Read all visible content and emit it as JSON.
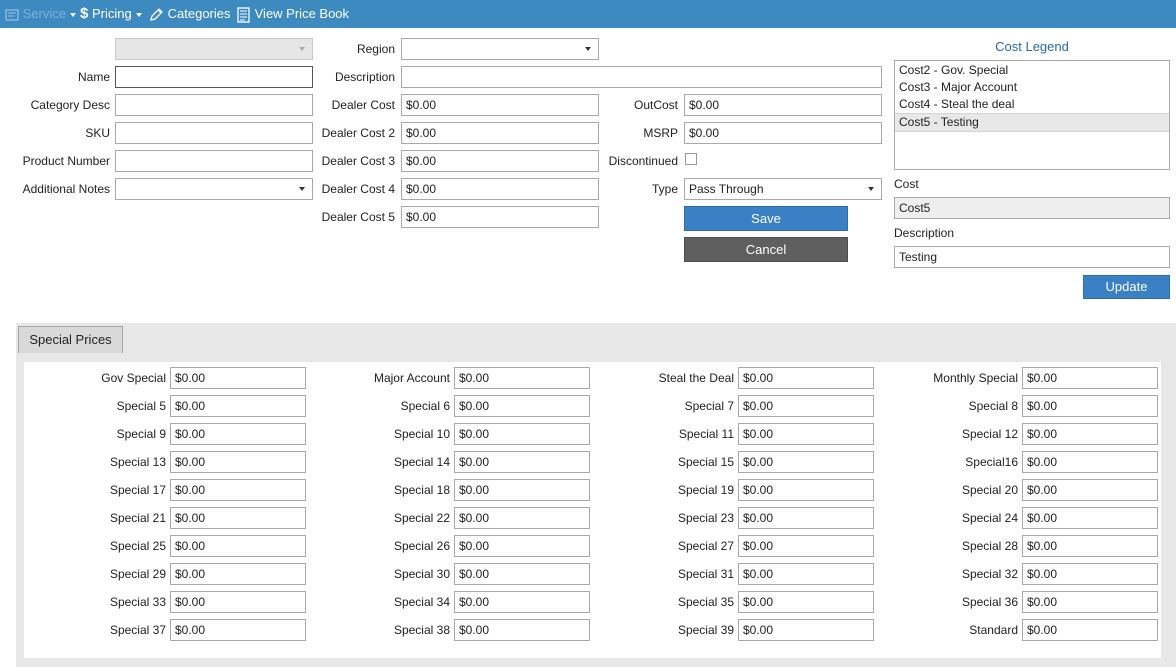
{
  "toolbar": {
    "service_label": "Service",
    "pricing_label": "Pricing",
    "categories_label": "Categories",
    "price_book_label": "View Price Book"
  },
  "form": {
    "top_select_value": "",
    "region_label": "Region",
    "region_value": "",
    "name_label": "Name",
    "name_value": "",
    "description_label": "Description",
    "description_value": "",
    "category_desc_label": "Category Desc",
    "category_desc_value": "",
    "dealer_cost_label": "Dealer Cost",
    "dealer_cost_value": "$0.00",
    "outcost_label": "OutCost",
    "outcost_value": "$0.00",
    "sku_label": "SKU",
    "sku_value": "",
    "dealer_cost2_label": "Dealer Cost 2",
    "dealer_cost2_value": "$0.00",
    "msrp_label": "MSRP",
    "msrp_value": "$0.00",
    "product_number_label": "Product Number",
    "product_number_value": "",
    "dealer_cost3_label": "Dealer Cost 3",
    "dealer_cost3_value": "$0.00",
    "discontinued_label": "Discontinued",
    "discontinued_checked": false,
    "additional_notes_label": "Additional Notes",
    "additional_notes_value": "",
    "dealer_cost4_label": "Dealer Cost 4",
    "dealer_cost4_value": "$0.00",
    "type_label": "Type",
    "type_value": "Pass Through",
    "dealer_cost5_label": "Dealer Cost 5",
    "dealer_cost5_value": "$0.00",
    "save_label": "Save",
    "cancel_label": "Cancel"
  },
  "legend": {
    "title": "Cost Legend",
    "items": [
      {
        "label": "Cost2 - Gov. Special",
        "selected": false
      },
      {
        "label": "Cost3 - Major Account",
        "selected": false
      },
      {
        "label": "Cost4 - Steal the deal",
        "selected": false
      },
      {
        "label": "Cost5 - Testing",
        "selected": true
      }
    ],
    "cost_label": "Cost",
    "cost_value": "Cost5",
    "description_label": "Description",
    "description_value": "Testing",
    "update_label": "Update"
  },
  "special_prices": {
    "tab_label": "Special Prices",
    "items": [
      {
        "label": "Gov Special",
        "value": "$0.00"
      },
      {
        "label": "Major Account",
        "value": "$0.00"
      },
      {
        "label": "Steal the Deal",
        "value": "$0.00"
      },
      {
        "label": "Monthly Special",
        "value": "$0.00"
      },
      {
        "label": "Special 5",
        "value": "$0.00"
      },
      {
        "label": "Special 6",
        "value": "$0.00"
      },
      {
        "label": "Special 7",
        "value": "$0.00"
      },
      {
        "label": "Special 8",
        "value": "$0.00"
      },
      {
        "label": "Special 9",
        "value": "$0.00"
      },
      {
        "label": "Special 10",
        "value": "$0.00"
      },
      {
        "label": "Special 11",
        "value": "$0.00"
      },
      {
        "label": "Special 12",
        "value": "$0.00"
      },
      {
        "label": "Special 13",
        "value": "$0.00"
      },
      {
        "label": "Special 14",
        "value": "$0.00"
      },
      {
        "label": "Special 15",
        "value": "$0.00"
      },
      {
        "label": "Special16",
        "value": "$0.00"
      },
      {
        "label": "Special 17",
        "value": "$0.00"
      },
      {
        "label": "Special 18",
        "value": "$0.00"
      },
      {
        "label": "Special 19",
        "value": "$0.00"
      },
      {
        "label": "Special 20",
        "value": "$0.00"
      },
      {
        "label": "Special 21",
        "value": "$0.00"
      },
      {
        "label": "Special 22",
        "value": "$0.00"
      },
      {
        "label": "Special 23",
        "value": "$0.00"
      },
      {
        "label": "Special 24",
        "value": "$0.00"
      },
      {
        "label": "Special 25",
        "value": "$0.00"
      },
      {
        "label": "Special 26",
        "value": "$0.00"
      },
      {
        "label": "Special 27",
        "value": "$0.00"
      },
      {
        "label": "Special 28",
        "value": "$0.00"
      },
      {
        "label": "Special 29",
        "value": "$0.00"
      },
      {
        "label": "Special 30",
        "value": "$0.00"
      },
      {
        "label": "Special 31",
        "value": "$0.00"
      },
      {
        "label": "Special 32",
        "value": "$0.00"
      },
      {
        "label": "Special 33",
        "value": "$0.00"
      },
      {
        "label": "Special 34",
        "value": "$0.00"
      },
      {
        "label": "Special 35",
        "value": "$0.00"
      },
      {
        "label": "Special 36",
        "value": "$0.00"
      },
      {
        "label": "Special 37",
        "value": "$0.00"
      },
      {
        "label": "Special 38",
        "value": "$0.00"
      },
      {
        "label": "Special 39",
        "value": "$0.00"
      },
      {
        "label": "Standard",
        "value": "$0.00"
      }
    ]
  }
}
